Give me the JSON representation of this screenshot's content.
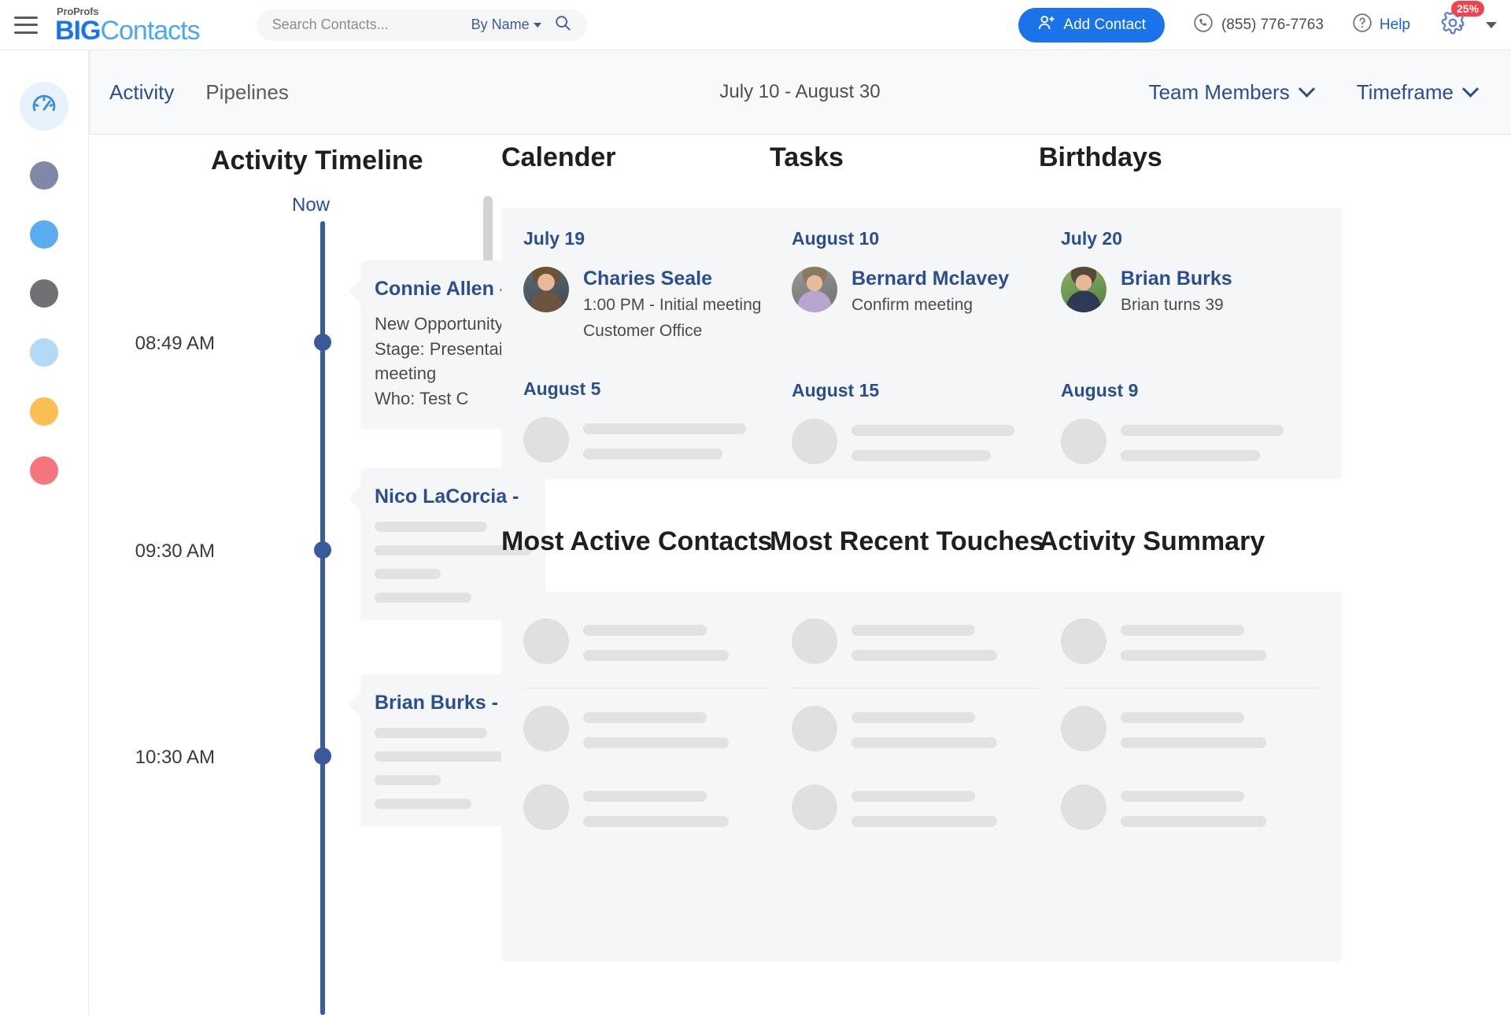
{
  "header": {
    "brand_small": "ProProfs",
    "brand_big": "BIG",
    "brand_rest": "Contacts",
    "search_placeholder": "Search Contacts...",
    "search_value": "",
    "search_scope": "By Name",
    "add_contact_label": "Add Contact",
    "phone": "(855) 776-7763",
    "help_label": "Help",
    "settings_badge": "25%"
  },
  "subnav": {
    "tabs": [
      {
        "label": "Activity",
        "active": true
      },
      {
        "label": "Pipelines",
        "active": false
      }
    ],
    "date_range": "July 10 - August 30",
    "team_members_label": "Team Members",
    "timeframe_label": "Timeframe"
  },
  "rail": {
    "dashboard_icon": "speedometer-icon",
    "dots": [
      {
        "name": "rail-dot-slate",
        "color": "#7f88a8"
      },
      {
        "name": "rail-dot-blue",
        "color": "#5aacf0"
      },
      {
        "name": "rail-dot-gray",
        "color": "#6f7174"
      },
      {
        "name": "rail-dot-lightblue",
        "color": "#b4d9f7"
      },
      {
        "name": "rail-dot-amber",
        "color": "#fbbe52"
      },
      {
        "name": "rail-dot-red",
        "color": "#f4757b"
      }
    ]
  },
  "timeline": {
    "title": "Activity Timeline",
    "now_label": "Now",
    "events": [
      {
        "time": "08:49 AM",
        "name": "Connie Allen -",
        "lines": [
          "New  Opportunity",
          "Stage: Presentaion meeting",
          "Who: Test C"
        ],
        "placeholder_bars": []
      },
      {
        "time": "09:30 AM",
        "name": "Nico LaCorcia -",
        "lines": [],
        "placeholder_bars": [
          72,
          100,
          42,
          62
        ]
      },
      {
        "time": "10:30 AM",
        "name": "Brian Burks -",
        "lines": [],
        "placeholder_bars": [
          72,
          100,
          42,
          62
        ]
      }
    ]
  },
  "calendar": {
    "title": "Calender",
    "entries": [
      {
        "date": "July 19",
        "name": "Charies Seale",
        "sub_lines": [
          "1:00 PM - Initial meeting",
          "Customer Office"
        ],
        "avatar": "photo-male-1",
        "placeholder": false
      },
      {
        "date": "August 5",
        "name": "",
        "sub_lines": [],
        "avatar": "placeholder-avatar",
        "placeholder": true
      }
    ]
  },
  "tasks": {
    "title": "Tasks",
    "entries": [
      {
        "date": "August 10",
        "name": "Bernard Mclavey",
        "sub_lines": [
          "Confirm meeting"
        ],
        "avatar": "photo-male-2",
        "placeholder": false
      },
      {
        "date": "August 15",
        "name": "",
        "sub_lines": [],
        "avatar": "placeholder-avatar",
        "placeholder": true
      }
    ]
  },
  "birthdays": {
    "title": "Birthdays",
    "entries": [
      {
        "date": "July 20",
        "name": "Brian Burks",
        "sub_lines": [
          "Brian turns 39"
        ],
        "avatar": "photo-male-3",
        "placeholder": false
      },
      {
        "date": "August 9",
        "name": "",
        "sub_lines": [],
        "avatar": "placeholder-avatar",
        "placeholder": true
      }
    ]
  },
  "most_active_contacts": {
    "title": "Most Active Contacts",
    "rows": 3
  },
  "most_recent_touches": {
    "title": "Most Recent Touches",
    "rows": 3
  },
  "activity_summary": {
    "title": "Activity Summary",
    "rows": 3
  },
  "colors": {
    "brand_blue": "#1976e8",
    "accent_blue": "#1a73e8",
    "nav_blue": "#2b4f8e",
    "timeline_blue": "#3a5b9b",
    "badge_red": "#f0434b",
    "panel_bg": "#f5f6f7"
  }
}
